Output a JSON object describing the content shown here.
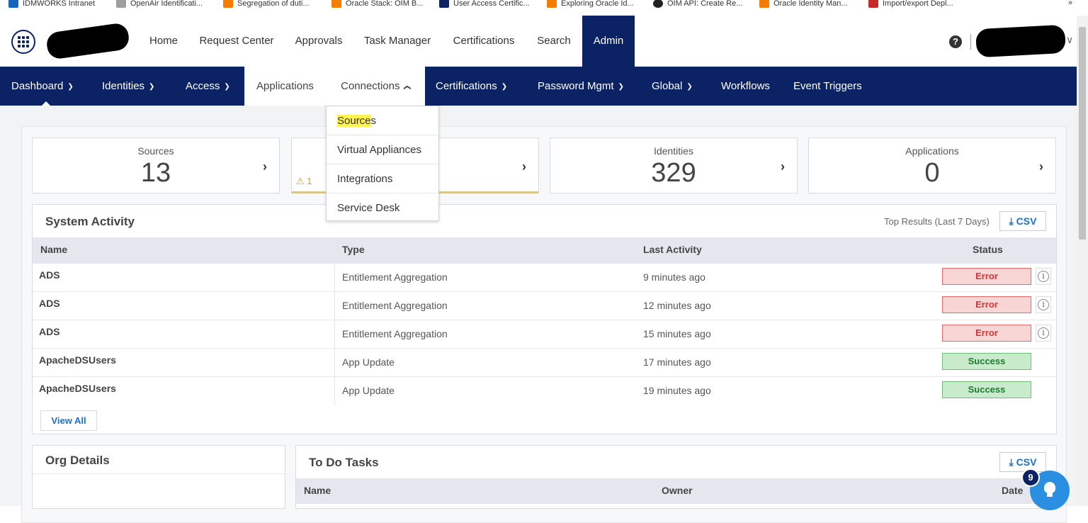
{
  "bookmarks": [
    {
      "label": "IDMWORKS Intranet",
      "color": "#1565c0"
    },
    {
      "label": "OpenAir Identificati...",
      "color": "#9e9e9e"
    },
    {
      "label": "Segregation of duti...",
      "color": "#f57c00"
    },
    {
      "label": "Oracle Stack: OIM B...",
      "color": "#f57c00"
    },
    {
      "label": "User Access Certific...",
      "color": "#0b2265"
    },
    {
      "label": "Exploring Oracle Id...",
      "color": "#f57c00"
    },
    {
      "label": "OIM API: Create Re...",
      "color": "#222222"
    },
    {
      "label": "Oracle Identity Man...",
      "color": "#f57c00"
    },
    {
      "label": "Import/export Depl...",
      "color": "#c62828"
    }
  ],
  "bookmarks_more": "»",
  "header": {
    "nav": [
      "Home",
      "Request Center",
      "Approvals",
      "Task Manager",
      "Certifications",
      "Search",
      "Admin"
    ],
    "active": "Admin",
    "help_glyph": "?",
    "user_chevron": "∨"
  },
  "subnav": {
    "items": [
      {
        "label": "Dashboard",
        "chevron": "down"
      },
      {
        "label": "Identities",
        "chevron": "down"
      },
      {
        "label": "Access",
        "chevron": "down"
      },
      {
        "label": "Applications",
        "chevron": ""
      },
      {
        "label": "Connections",
        "chevron": "up"
      },
      {
        "label": "Certifications",
        "chevron": "down"
      },
      {
        "label": "Password Mgmt",
        "chevron": "down"
      },
      {
        "label": "Global",
        "chevron": "down"
      },
      {
        "label": "Workflows",
        "chevron": ""
      },
      {
        "label": "Event Triggers",
        "chevron": ""
      }
    ]
  },
  "dropdown": {
    "items": [
      "Sources",
      "Virtual Appliances",
      "Integrations",
      "Service Desk"
    ],
    "highlight_part": "Source",
    "highlight_rest": "s"
  },
  "cards": [
    {
      "label": "Sources",
      "value": "13",
      "arrow": "›"
    },
    {
      "label": "",
      "value": "",
      "arrow": "›",
      "warning_count": "1",
      "warning_glyph": "⚠"
    },
    {
      "label": "Identities",
      "value": "329",
      "arrow": "›"
    },
    {
      "label": "Applications",
      "value": "0",
      "arrow": "›"
    }
  ],
  "system_activity": {
    "title": "System Activity",
    "top_results": "Top Results (Last 7 Days)",
    "csv_label": "CSV",
    "download_glyph": "⤓",
    "columns": [
      "Name",
      "Type",
      "Last Activity",
      "Status"
    ],
    "rows": [
      {
        "name": "ADS",
        "type": "Entitlement Aggregation",
        "last": "9 minutes ago",
        "status": "Error"
      },
      {
        "name": "ADS",
        "type": "Entitlement Aggregation",
        "last": "12 minutes ago",
        "status": "Error"
      },
      {
        "name": "ADS",
        "type": "Entitlement Aggregation",
        "last": "15 minutes ago",
        "status": "Error"
      },
      {
        "name": "ApacheDSUsers",
        "type": "App Update",
        "last": "17 minutes ago",
        "status": "Success"
      },
      {
        "name": "ApacheDSUsers",
        "type": "App Update",
        "last": "19 minutes ago",
        "status": "Success"
      }
    ],
    "info_glyph": "i",
    "view_all": "View All"
  },
  "org_details": {
    "title": "Org Details"
  },
  "todo": {
    "title": "To Do Tasks",
    "csv_label": "CSV",
    "columns": [
      "Name",
      "Owner",
      "Date"
    ]
  },
  "fab": {
    "count": "9"
  },
  "colors": {
    "navy": "#0b2265",
    "error_bg": "#f9d6d6",
    "success_bg": "#c8eccb",
    "link": "#1a6fd0",
    "highlight": "#fff34d"
  }
}
